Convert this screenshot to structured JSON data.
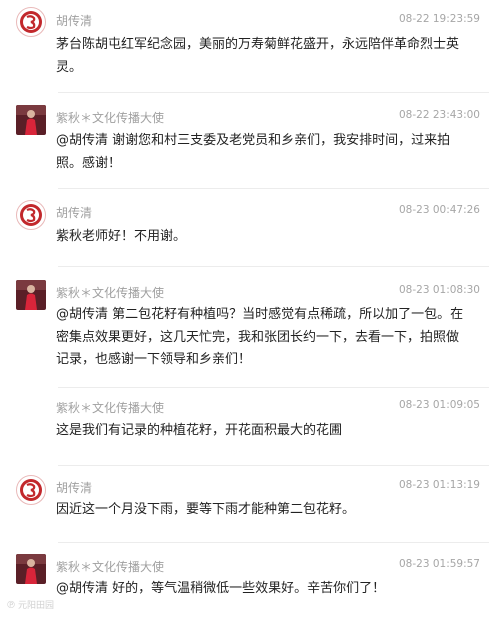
{
  "comments": [
    {
      "user": "胡传清",
      "avatar_type": "logo",
      "time": "08-22 19:23:59",
      "text": "茅台陈胡屯红军纪念园，美丽的万寿菊鲜花盛开，永远陪伴革命烈士英灵。"
    },
    {
      "user": "紫秋＊文化传播大使",
      "avatar_type": "photo",
      "time": "08-22 23:43:00",
      "text": "@胡传清 谢谢您和村三支委及老党员和乡亲们，我安排时间，过来拍照。感谢！"
    },
    {
      "user": "胡传清",
      "avatar_type": "logo",
      "time": "08-23 00:47:26",
      "text": "紫秋老师好！不用谢。"
    },
    {
      "user": "紫秋＊文化传播大使",
      "avatar_type": "photo",
      "time": "08-23 01:08:30",
      "text": "@胡传清 第二包花籽有种植吗？当时感觉有点稀疏，所以加了一包。在密集点效果更好，这几天忙完，我和张团长约一下，去看一下，拍照做记录，也感谢一下领导和乡亲们！"
    },
    {
      "user": "紫秋＊文化传播大使",
      "avatar_type": "none",
      "time": "08-23 01:09:05",
      "text": "这是我们有记录的种植花籽，开花面积最大的花圃"
    },
    {
      "user": "胡传清",
      "avatar_type": "logo",
      "time": "08-23 01:13:19",
      "text": "因近这一个月没下雨，要等下雨才能种第二包花籽。"
    },
    {
      "user": "紫秋＊文化传播大使",
      "avatar_type": "photo",
      "time": "08-23 01:59:57",
      "text": "@胡传清 好的，等气温稍微低一些效果好。辛苦你们了！"
    }
  ],
  "watermark": {
    "mark": "℗",
    "text": "元阳田园"
  },
  "colors": {
    "logo_red": "#c2282c",
    "photo_bg": "#5a1f27",
    "text": "#222222",
    "meta": "#a0a0a0"
  }
}
